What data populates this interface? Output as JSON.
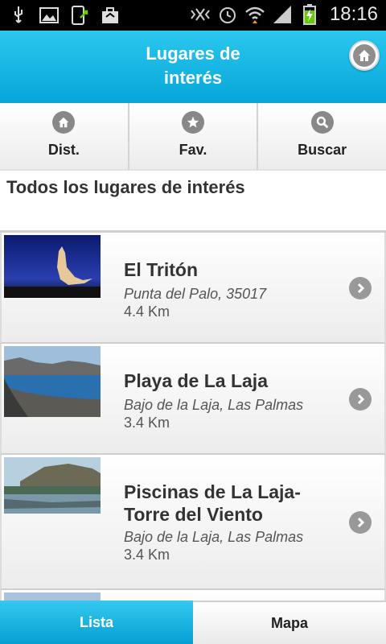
{
  "statusbar": {
    "time": "18:16",
    "icons": [
      "usb-icon",
      "image-icon",
      "phone-sync-icon",
      "bag-icon",
      "vibrate-icon",
      "alarm-icon",
      "wifi-icon",
      "signal-icon",
      "battery-charging-icon"
    ]
  },
  "header": {
    "title_line1": "Lugares de",
    "title_line2": "interés",
    "home_icon": "home-icon"
  },
  "toptabs": [
    {
      "label": "Dist.",
      "icon": "home-icon"
    },
    {
      "label": "Fav.",
      "icon": "star-icon"
    },
    {
      "label": "Buscar",
      "icon": "search-icon"
    }
  ],
  "section_title": "Todos los lugares de interés",
  "places": [
    {
      "name_line1": "El Tritón",
      "name_line2": "",
      "address": "Punta del Palo, 35017",
      "distance": "4.4 Km"
    },
    {
      "name_line1": "Playa de La Laja",
      "name_line2": "",
      "address": "Bajo de la Laja, Las Palmas",
      "distance": "3.4 Km"
    },
    {
      "name_line1": "Piscinas de La Laja-",
      "name_line2": "Torre del Viento",
      "address": "Bajo de la Laja, Las Palmas",
      "distance": "3.4 Km"
    }
  ],
  "bottomtabs": [
    {
      "label": "Lista",
      "active": true
    },
    {
      "label": "Mapa",
      "active": false
    }
  ],
  "colors": {
    "accent": "#05a6d8",
    "accent_light": "#2bc7ef",
    "icon_gray": "#888888"
  }
}
